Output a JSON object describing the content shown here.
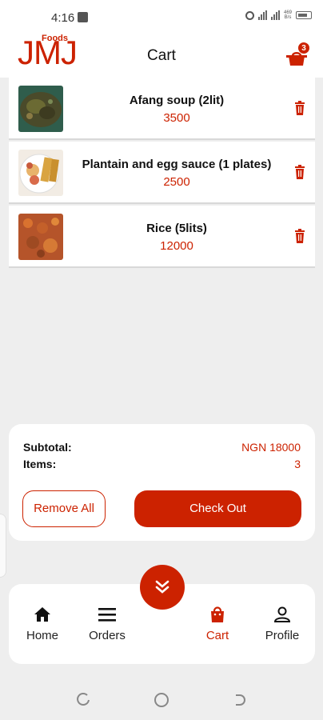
{
  "status_bar": {
    "time": "4:16",
    "net_speed_top": "469",
    "net_speed_bottom": "B/s"
  },
  "header": {
    "logo_main": "JMJ",
    "logo_sub": "Foods",
    "title": "Cart",
    "cart_count": "3"
  },
  "cart_items": [
    {
      "name": "Afang soup (2lit)",
      "price": "3500"
    },
    {
      "name": "Plantain and egg sauce (1 plates)",
      "price": "2500"
    },
    {
      "name": "Rice (5lits)",
      "price": "12000"
    }
  ],
  "summary": {
    "subtotal_label": "Subtotal:",
    "subtotal_value": "NGN 18000",
    "items_label": "Items:",
    "items_value": "3",
    "remove_all_label": "Remove All",
    "checkout_label": "Check Out"
  },
  "bottom_nav": {
    "items": [
      {
        "label": "Home",
        "icon": "home-icon"
      },
      {
        "label": "Orders",
        "icon": "menu-icon"
      },
      {
        "label": "Cart",
        "icon": "shopping-bag-icon",
        "active": true
      },
      {
        "label": "Profile",
        "icon": "person-icon"
      }
    ]
  },
  "colors": {
    "accent": "#cc2200",
    "background": "#eeeeee",
    "card": "#ffffff"
  }
}
